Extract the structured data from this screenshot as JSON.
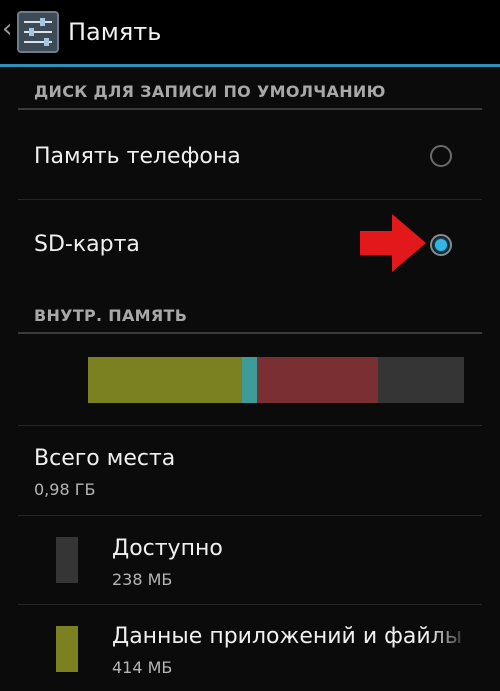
{
  "actionbar": {
    "title": "Память",
    "back_icon": "chevron-left-icon",
    "app_icon": "settings-sliders-icon"
  },
  "default_disk": {
    "header": "ДИСК ДЛЯ ЗАПИСИ ПО УМОЛЧАНИЮ",
    "options": [
      {
        "label": "Память телефона",
        "selected": false
      },
      {
        "label": "SD-карта",
        "selected": true
      }
    ]
  },
  "internal": {
    "header": "ВНУТР. ПАМЯТЬ",
    "usage_bar": {
      "segments": [
        {
          "name": "apps",
          "fraction": 0.41,
          "color": "#7b8120"
        },
        {
          "name": "other",
          "fraction": 0.04,
          "color": "#3f9a9a"
        },
        {
          "name": "misc",
          "fraction": 0.32,
          "color": "#7a2f33"
        },
        {
          "name": "available",
          "fraction": 0.23,
          "color": "#353535"
        }
      ]
    },
    "total": {
      "label": "Всего места",
      "value": "0,98 ГБ"
    },
    "items": [
      {
        "label": "Доступно",
        "value": "238 МБ",
        "color": "#353535"
      },
      {
        "label": "Данные приложений и файлы",
        "value": "414 МБ",
        "color": "#7b8120"
      }
    ]
  },
  "colors": {
    "accent": "#34b5e5",
    "holo_line": "#2f8fb7",
    "annotation_arrow": "#e3181b"
  }
}
